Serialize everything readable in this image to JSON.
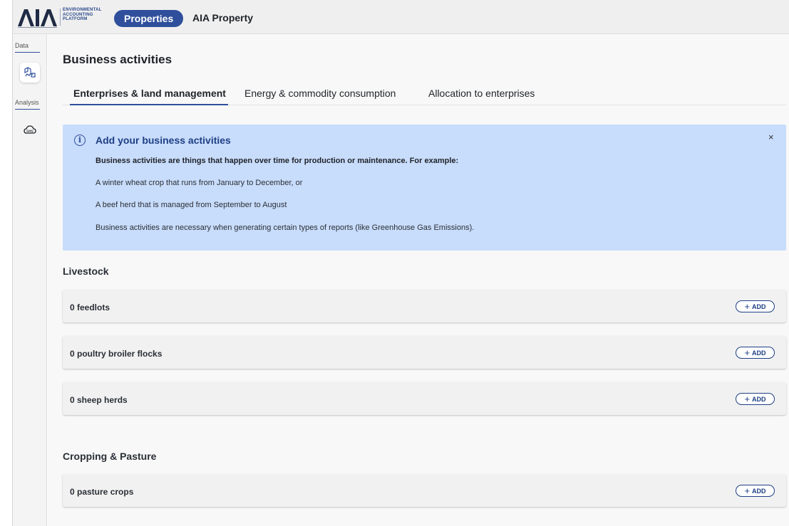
{
  "header": {
    "logo_letters": "AIA",
    "logo_tagline": [
      "ENVIRONMENTAL",
      "ACCOUNTING",
      "PLATFORM"
    ],
    "nav_pill": "Properties",
    "property_name": "AIA Property"
  },
  "rail": {
    "data_label": "Data",
    "analysis_label": "Analysis",
    "items": [
      {
        "name": "business-activities-icon",
        "active": true
      },
      {
        "name": "ghg-icon",
        "active": false
      }
    ]
  },
  "page": {
    "title": "Business activities"
  },
  "tabs": [
    {
      "label": "Enterprises & land management",
      "active": true
    },
    {
      "label": "Energy & commodity consumption",
      "active": false
    },
    {
      "label": "Allocation to enterprises",
      "active": false
    }
  ],
  "banner": {
    "icon": "info-icon",
    "title": "Add your business activities",
    "close": "×",
    "lines": [
      "Business activities are things that happen over time for production or maintenance. For example:",
      "A winter wheat crop that runs from January to December, or",
      "A beef herd that is managed from September to August",
      "Business activities are necessary when generating certain types of reports (like Greenhouse Gas Emissions)."
    ]
  },
  "sections": [
    {
      "title": "Livestock",
      "items": [
        {
          "label": "0 feedlots",
          "button": "ADD"
        },
        {
          "label": "0 poultry broiler flocks",
          "button": "ADD"
        },
        {
          "label": "0 sheep herds",
          "button": "ADD"
        }
      ]
    },
    {
      "title": "Cropping & Pasture",
      "items": [
        {
          "label": "0 pasture crops",
          "button": "ADD"
        }
      ]
    }
  ],
  "colors": {
    "brand": "#2f4f9c",
    "banner_bg": "#c8dcfb",
    "banner_title": "#1e3f85"
  }
}
